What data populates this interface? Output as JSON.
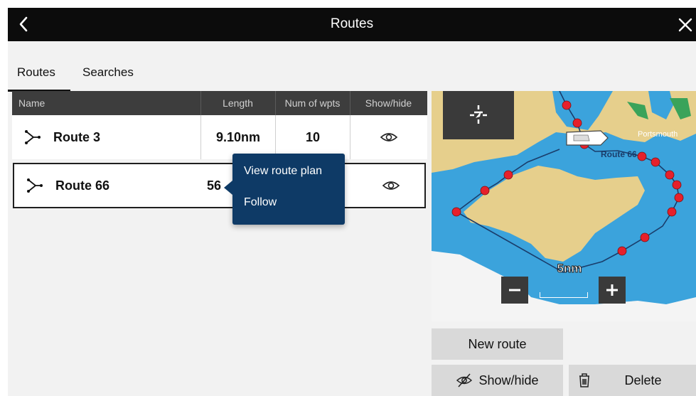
{
  "header": {
    "title": "Routes"
  },
  "tabs": [
    {
      "label": "Routes",
      "active": true
    },
    {
      "label": "Searches",
      "active": false
    }
  ],
  "table": {
    "columns": [
      "Name",
      "Length",
      "Num of wpts",
      "Show/hide"
    ],
    "rows": [
      {
        "name": "Route 3",
        "length": "9.10nm",
        "waypoints": "10",
        "visible": true
      },
      {
        "name": "Route 66",
        "length": "56",
        "waypoints": "",
        "visible": true,
        "selected": true
      }
    ]
  },
  "context_menu": {
    "items": [
      "View route plan",
      "Follow"
    ]
  },
  "map": {
    "place_label": "Portsmouth",
    "route_label": "Route 66",
    "scale": "5nm",
    "colors": {
      "sea": "#3ba3dc",
      "land": "#e6cf8c",
      "route": "#1a3d6b",
      "waypoint": "#e6202b"
    }
  },
  "buttons": {
    "new_route": "New route",
    "show_hide": "Show/hide",
    "delete": "Delete"
  },
  "icons": {
    "back": "chevron-left-icon",
    "close": "close-icon",
    "route": "route-icon",
    "eye": "eye-icon",
    "eye_off": "eye-off-icon",
    "trash": "trash-icon",
    "center": "center-vessel-icon",
    "zoom_out": "minus-icon",
    "zoom_in": "plus-icon"
  }
}
